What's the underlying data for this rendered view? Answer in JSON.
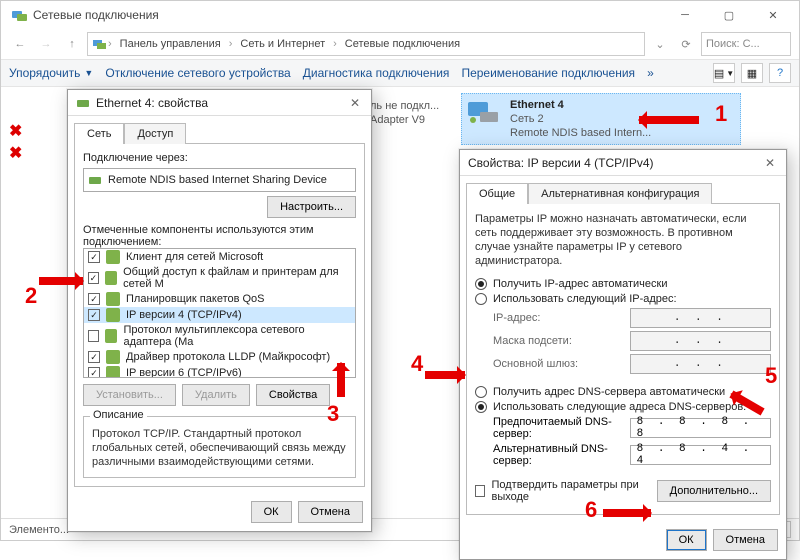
{
  "window": {
    "title": "Сетевые подключения",
    "crumbs": [
      "Панель управления",
      "Сеть и Интернет",
      "Сетевые подключения"
    ],
    "search_placeholder": "Поиск: С...",
    "menu": {
      "organize": "Упорядочить",
      "disable": "Отключение сетевого устройства",
      "diag": "Диагностика подключения",
      "rename": "Переименование подключения",
      "more": "»"
    },
    "status": "Элементо...",
    "adapter_partial_a": "ль не подкл...",
    "adapter_partial_b": "Adapter V9",
    "adapter_sel": {
      "name": "Ethernet 4",
      "net": "Сеть 2",
      "dev": "Remote NDIS based Intern..."
    }
  },
  "props_dialog": {
    "title": "Ethernet 4: свойства",
    "tabs": {
      "net": "Сеть",
      "access": "Доступ"
    },
    "connect_via_label": "Подключение через:",
    "adapter_name": "Remote NDIS based Internet Sharing Device",
    "configure": "Настроить...",
    "components_label": "Отмеченные компоненты используются этим подключением:",
    "items": [
      {
        "checked": true,
        "label": "Клиент для сетей Microsoft"
      },
      {
        "checked": true,
        "label": "Общий доступ к файлам и принтерам для сетей M"
      },
      {
        "checked": true,
        "label": "Планировщик пакетов QoS"
      },
      {
        "checked": true,
        "label": "IP версии 4 (TCP/IPv4)",
        "selected": true
      },
      {
        "checked": false,
        "label": "Протокол мультиплексора сетевого адаптера (Ma"
      },
      {
        "checked": true,
        "label": "Драйвер протокола LLDP (Майкрософт)"
      },
      {
        "checked": true,
        "label": "IP версии 6 (TCP/IPv6)"
      }
    ],
    "buttons": {
      "install": "Установить...",
      "remove": "Удалить",
      "props": "Свойства"
    },
    "desc_heading": "Описание",
    "desc_text": "Протокол TCP/IP. Стандартный протокол глобальных сетей, обеспечивающий связь между различными взаимодействующими сетями.",
    "ok": "ОК",
    "cancel": "Отмена"
  },
  "ipv4_dialog": {
    "title": "Свойства: IP версии 4 (TCP/IPv4)",
    "tabs": {
      "general": "Общие",
      "alt": "Альтернативная конфигурация"
    },
    "intro": "Параметры IP можно назначать автоматически, если сеть поддерживает эту возможность. В противном случае узнайте параметры IP у сетевого администратора.",
    "r_ip_auto": "Получить IP-адрес автоматически",
    "r_ip_manual": "Использовать следующий IP-адрес:",
    "f_ip": "IP-адрес:",
    "f_mask": "Маска подсети:",
    "f_gw": "Основной шлюз:",
    "r_dns_auto": "Получить адрес DNS-сервера автоматически",
    "r_dns_manual": "Использовать следующие адреса DNS-серверов:",
    "f_dns1": "Предпочитаемый DNS-сервер:",
    "f_dns2": "Альтернативный DNS-сервер:",
    "dns1_value": "8 . 8 . 8 . 8",
    "dns2_value": "8 . 8 . 4 . 4",
    "validate": "Подтвердить параметры при выходе",
    "advanced": "Дополнительно...",
    "ok": "ОК",
    "cancel": "Отмена"
  },
  "annotations": {
    "n1": "1",
    "n2": "2",
    "n3": "3",
    "n4": "4",
    "n5": "5",
    "n6": "6"
  }
}
